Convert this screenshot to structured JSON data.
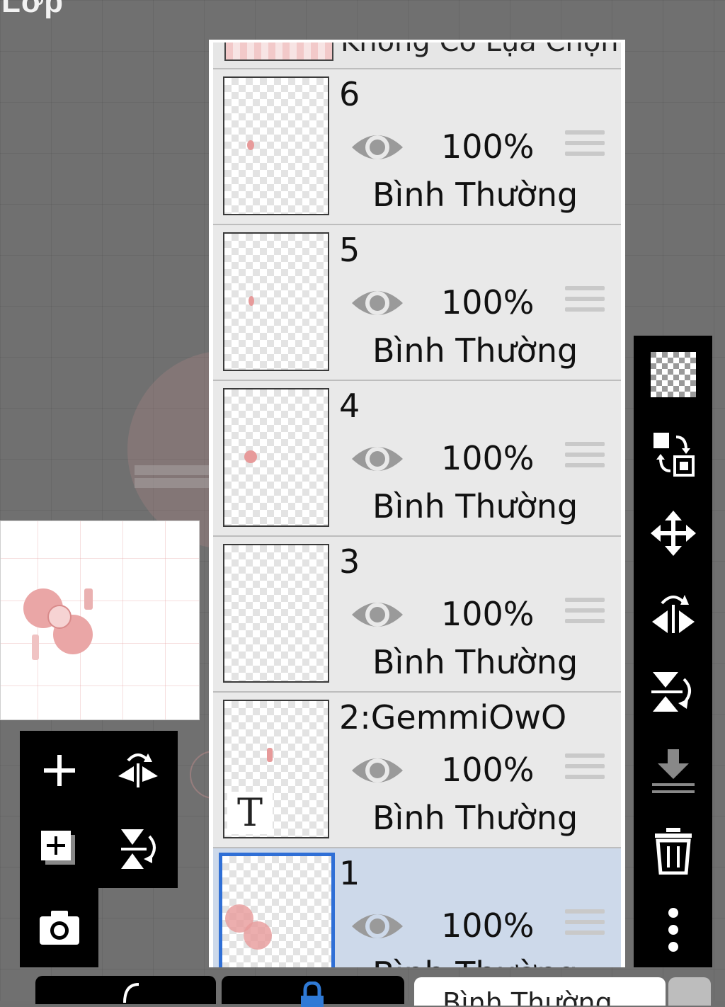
{
  "window": {
    "title": "Lớp"
  },
  "layers_panel": {
    "top_layer_partial_label": "Không Có Lựa Chọn",
    "layers": [
      {
        "name": "6",
        "opacity": "100%",
        "blend_mode": "Bình Thường",
        "visible": true,
        "selected": false
      },
      {
        "name": "5",
        "opacity": "100%",
        "blend_mode": "Bình Thường",
        "visible": true,
        "selected": false
      },
      {
        "name": "4",
        "opacity": "100%",
        "blend_mode": "Bình Thường",
        "visible": true,
        "selected": false
      },
      {
        "name": "3",
        "opacity": "100%",
        "blend_mode": "Bình Thường",
        "visible": true,
        "selected": false
      },
      {
        "name": "2:GemmiOwO",
        "opacity": "100%",
        "blend_mode": "Bình Thường",
        "visible": true,
        "selected": false,
        "is_text_layer": true,
        "text_marker": "T"
      },
      {
        "name": "1",
        "opacity": "100%",
        "blend_mode": "Bình Thường",
        "visible": true,
        "selected": true
      }
    ]
  },
  "left_toolbar": {
    "icons": [
      "add-layer-icon",
      "flip-horizontal-icon",
      "add-layer-copy-icon",
      "flip-vertical-icon",
      "camera-icon"
    ]
  },
  "right_toolbar": {
    "icons": [
      "transparency-checker-icon",
      "swap-layers-icon",
      "move-icon",
      "flip-horizontal-icon",
      "flip-vertical-icon",
      "merge-down-icon",
      "trash-icon",
      "more-options-icon"
    ]
  },
  "bottom_bar": {
    "blend_mode_select": "Bình Thường"
  },
  "colors": {
    "selected_row": "#cdd9ea",
    "selection_border": "#2f6fd6",
    "toolbar_bg": "#000000",
    "canvas_bg": "#707070",
    "accent_lock": "#2f7ad6"
  }
}
